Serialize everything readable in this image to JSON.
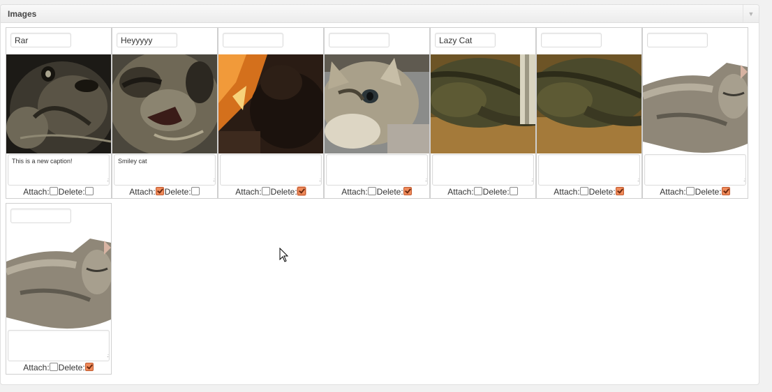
{
  "panel": {
    "title": "Images",
    "toggle_icon": "triangle-down-icon"
  },
  "labels": {
    "attach": "Attach:",
    "delete": "Delete:"
  },
  "images": [
    {
      "title": "Rar",
      "caption": "This is a new caption!",
      "attach": false,
      "delete": false,
      "photo": "dark tabby kitten close-up"
    },
    {
      "title": "Heyyyyy",
      "caption": "Smiley cat",
      "attach": true,
      "delete": false,
      "photo": "tabby kitten mouth open"
    },
    {
      "title": "",
      "caption": "",
      "attach": false,
      "delete": true,
      "photo": "dark cat against orange light"
    },
    {
      "title": "",
      "caption": "",
      "attach": false,
      "delete": true,
      "photo": "tabby kitten looking up"
    },
    {
      "title": "Lazy Cat",
      "caption": "",
      "attach": false,
      "delete": false,
      "photo": "cat sleeping on carpet"
    },
    {
      "title": "",
      "caption": "",
      "attach": false,
      "delete": true,
      "photo": "cat sleeping on carpet"
    },
    {
      "title": "",
      "caption": "",
      "attach": false,
      "delete": true,
      "photo": "grey cat cutout on white"
    },
    {
      "title": "",
      "caption": "",
      "attach": false,
      "delete": true,
      "photo": "grey cat cutout on white"
    }
  ]
}
